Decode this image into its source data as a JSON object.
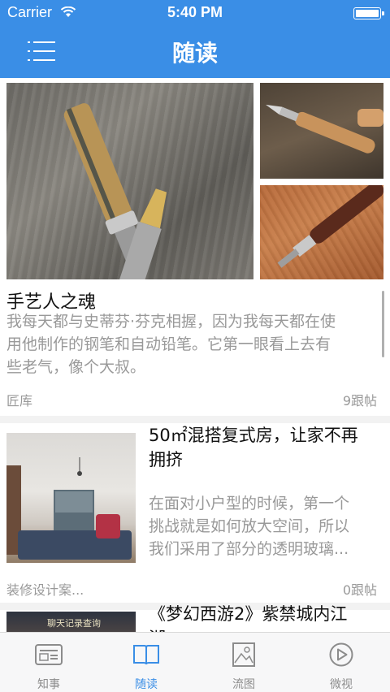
{
  "status_bar": {
    "carrier": "Carrier",
    "time": "5:40 PM"
  },
  "nav": {
    "title": "随读",
    "menu_icon": "menu-icon"
  },
  "featured": {
    "title": "手艺人之魂",
    "excerpt_lines": [
      "我每天都与史蒂芬·芬克相握，因为我每天都在使",
      "用他制作的钢笔和自动铅笔。它第一眼看上去有",
      "些老气，像个大叔。"
    ],
    "source": "匠库",
    "replies": "9跟帖"
  },
  "articles": [
    {
      "title_lines": [
        "50㎡混搭复式房，让家不再",
        "拥挤"
      ],
      "excerpt_lines": [
        "在面对小户型的时候，第一个",
        "挑战就是如何放大空间，所以",
        "我们采用了部分的透明玻璃..."
      ],
      "source": "装修设计案...",
      "replies": "0跟帖"
    },
    {
      "title_lines": [
        "《梦幻西游2》紫禁城内江",
        "湖"
      ],
      "thumb_text": "聊天记录查询"
    }
  ],
  "tabs": [
    {
      "label": "知事",
      "icon": "news-icon",
      "active": false
    },
    {
      "label": "随读",
      "icon": "book-icon",
      "active": true
    },
    {
      "label": "流图",
      "icon": "picture-icon",
      "active": false
    },
    {
      "label": "微视",
      "icon": "play-icon",
      "active": false
    }
  ],
  "colors": {
    "accent": "#3a8ee6",
    "muted": "#999999"
  }
}
